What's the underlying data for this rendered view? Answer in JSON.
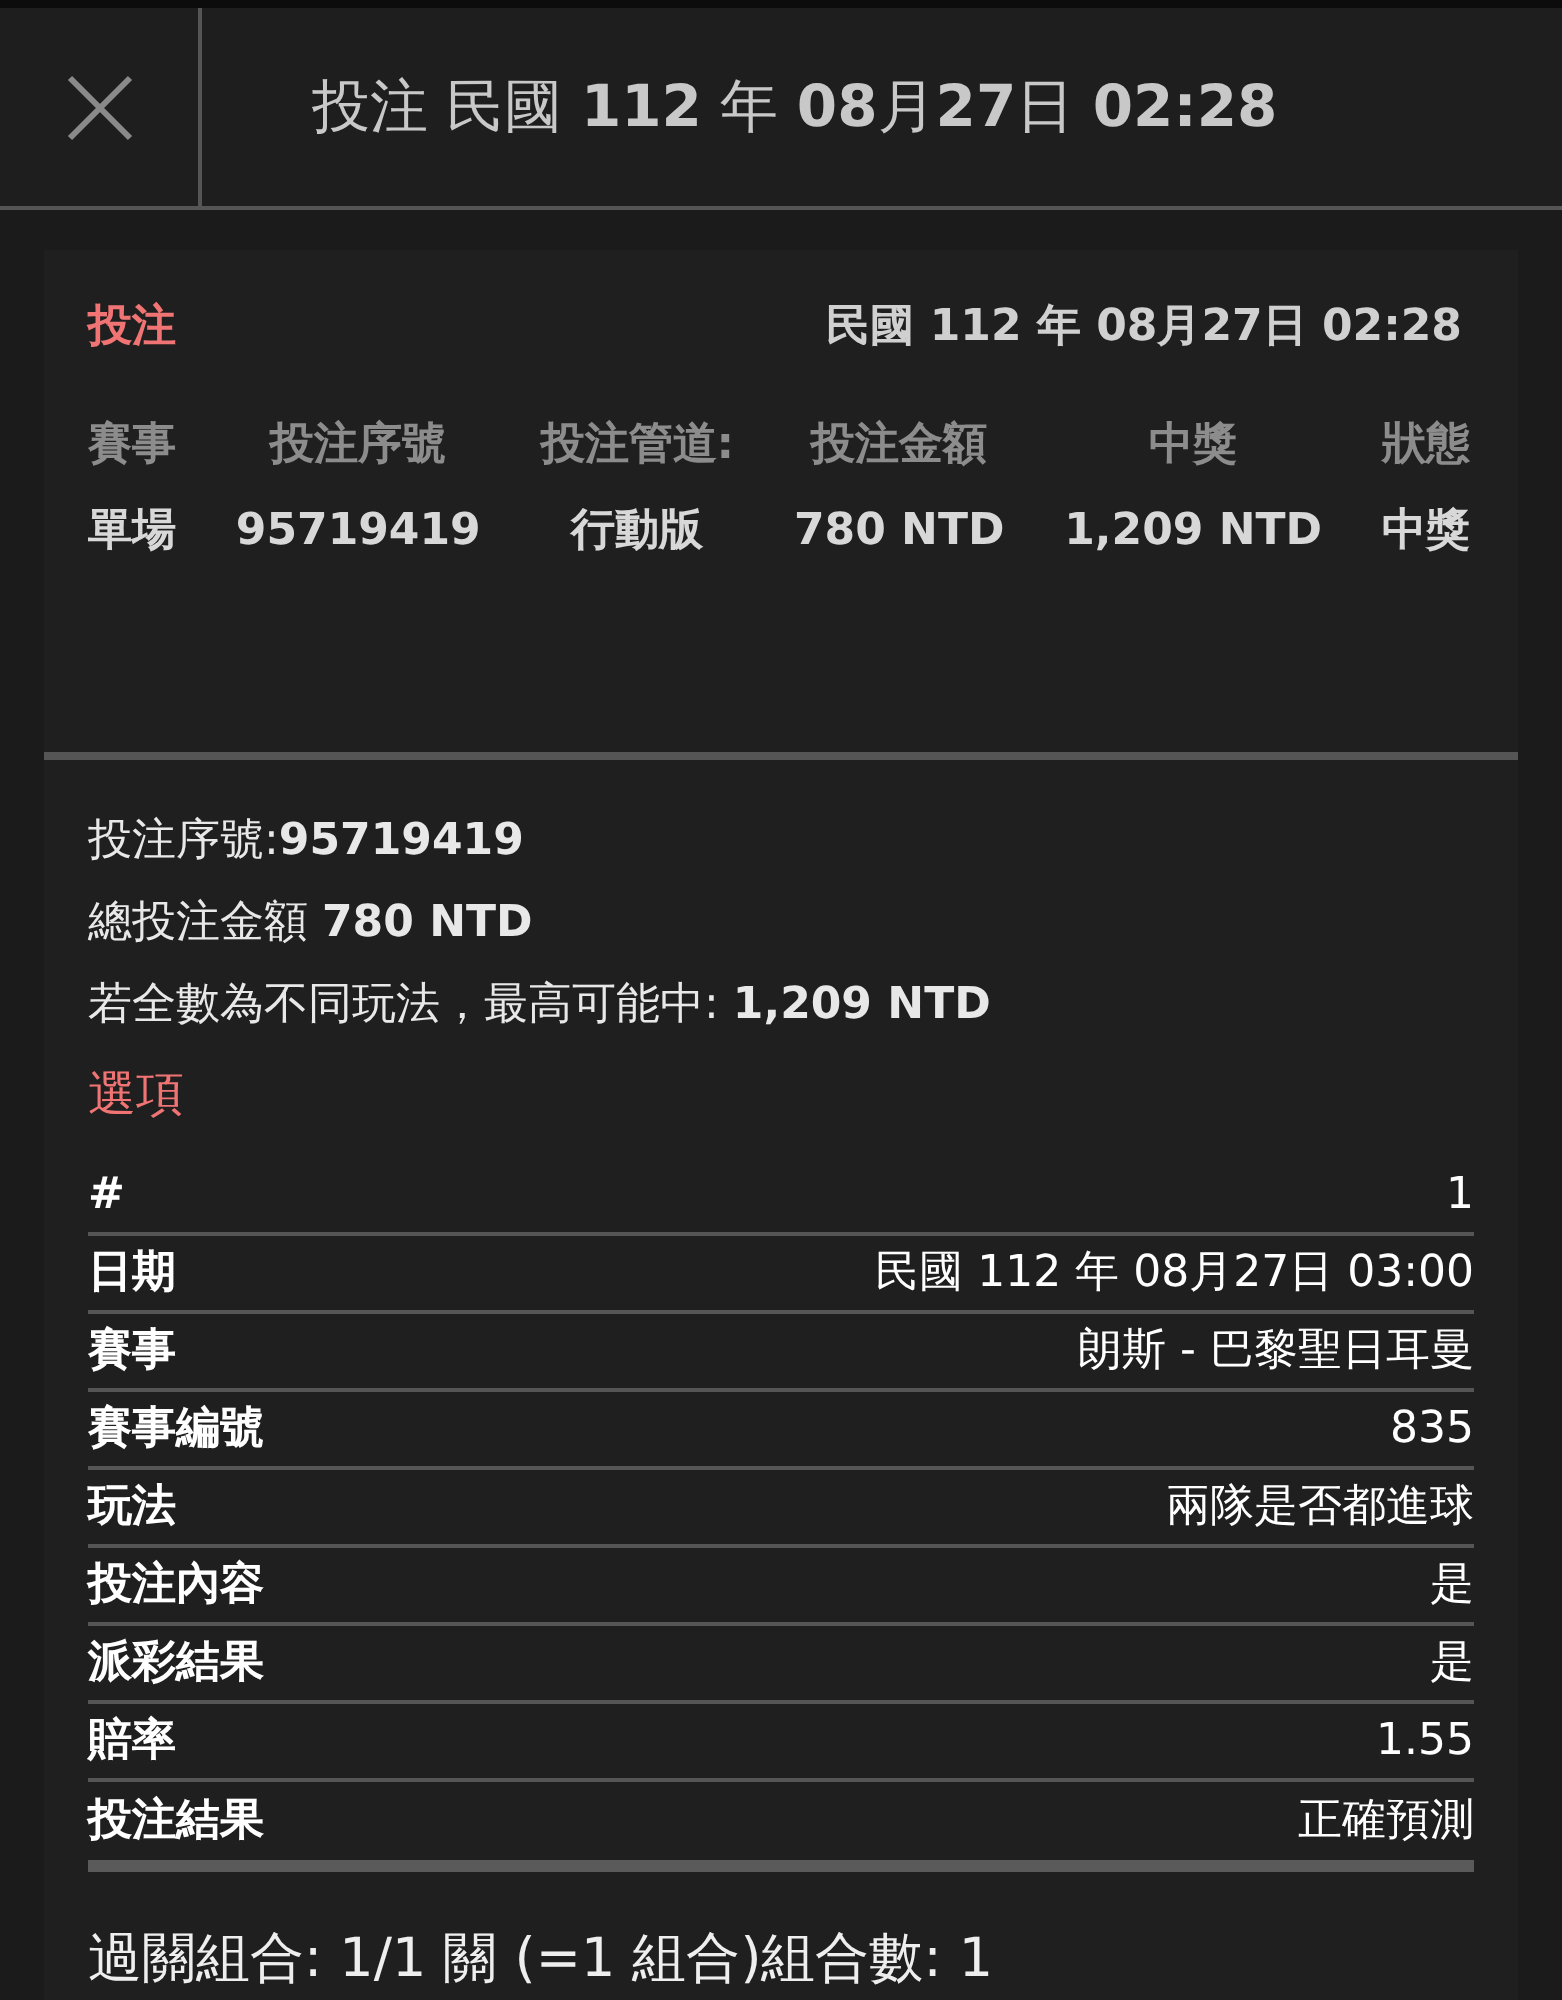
{
  "header": {
    "title": "投注 民國 **112** 年 **08**月**27**日 **02:28**"
  },
  "bet": {
    "label": "投注",
    "datetime": "民國 112 年 08月27日 02:28",
    "columns": [
      {
        "heading": "賽事",
        "value": "單場"
      },
      {
        "heading": "投注序號",
        "value": "95719419"
      },
      {
        "heading": "投注管道:",
        "value": "行動版"
      },
      {
        "heading": "投注金額",
        "value": "780 NTD"
      },
      {
        "heading": "中獎",
        "value": "1,209 NTD"
      },
      {
        "heading": "狀態",
        "value": "中獎"
      }
    ]
  },
  "summary": [
    "投注序號:**95719419**",
    "總投注金額 **780 NTD**",
    "若全數為不同玩法，最高可能中: **1,209 NTD**"
  ],
  "options": {
    "title": "選項",
    "rows": [
      {
        "label": "#",
        "value": "1"
      },
      {
        "label": "日期",
        "value": "民國 112 年 08月27日 03:00"
      },
      {
        "label": "賽事",
        "value": "朗斯 - 巴黎聖日耳曼"
      },
      {
        "label": "賽事編號",
        "value": "835"
      },
      {
        "label": "玩法",
        "value": "兩隊是否都進球"
      },
      {
        "label": "投注內容",
        "value": "是"
      },
      {
        "label": "派彩結果",
        "value": "是"
      },
      {
        "label": "賠率",
        "value": "1.55"
      },
      {
        "label": "投注結果",
        "value": "正確預測"
      }
    ]
  },
  "footer": "過關組合: 1/1 關 (=1 組合)組合數: 1"
}
